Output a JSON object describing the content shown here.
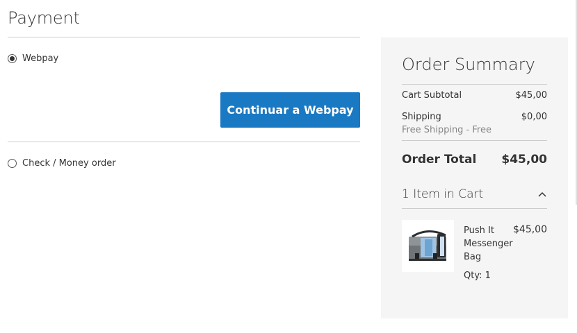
{
  "payment": {
    "title": "Payment",
    "methods": [
      {
        "label": "Webpay",
        "selected": true
      },
      {
        "label": "Check / Money order",
        "selected": false
      }
    ],
    "continue_button": "Continuar a Webpay"
  },
  "summary": {
    "title": "Order Summary",
    "cart_subtotal_label": "Cart Subtotal",
    "cart_subtotal_value": "$45,00",
    "shipping_label": "Shipping",
    "shipping_value": "$0,00",
    "shipping_note": "Free Shipping - Free",
    "order_total_label": "Order Total",
    "order_total_value": "$45,00",
    "items_in_cart": "1 Item in Cart",
    "items": [
      {
        "name": "Push It Messenger Bag",
        "price": "$45,00",
        "qty": "Qty: 1"
      }
    ]
  },
  "colors": {
    "primary_button": "#1979c3",
    "summary_background": "#f5f5f5"
  }
}
